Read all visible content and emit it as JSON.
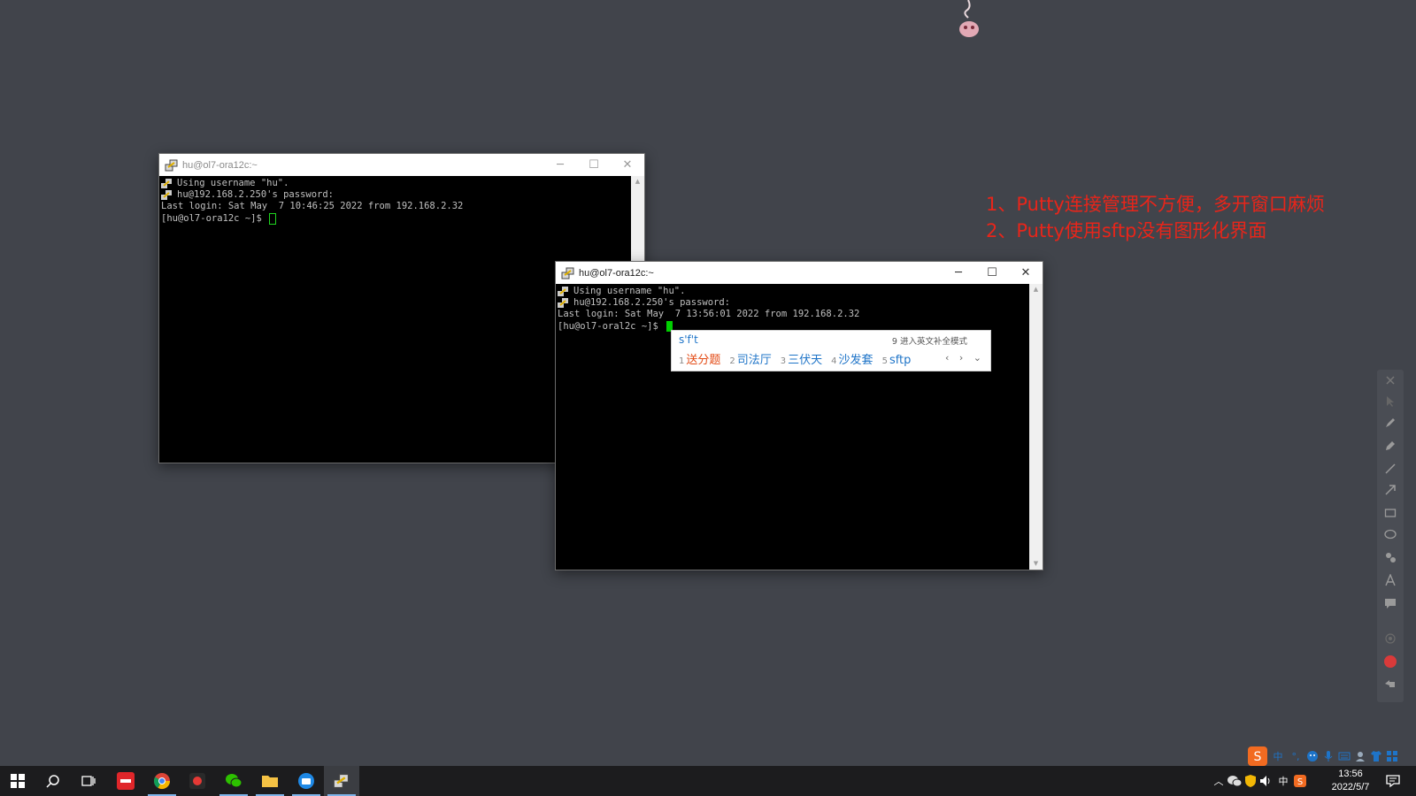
{
  "windows": [
    {
      "title": "hu@ol7-ora12c:~",
      "lines": [
        {
          "icon": true,
          "text": "Using username \"hu\"."
        },
        {
          "icon": true,
          "text": "hu@192.168.2.250's password:"
        },
        {
          "icon": false,
          "text": "Last login: Sat May  7 10:46:25 2022 from 192.168.2.32"
        },
        {
          "icon": false,
          "text": "[hu@ol7-ora12c ~]$ "
        }
      ]
    },
    {
      "title": "hu@ol7-ora12c:~",
      "lines": [
        {
          "icon": true,
          "text": "Using username \"hu\"."
        },
        {
          "icon": true,
          "text": "hu@192.168.2.250's password:"
        },
        {
          "icon": false,
          "text": "Last login: Sat May  7 13:56:01 2022 from 192.168.2.32"
        },
        {
          "icon": false,
          "text": "[hu@ol7-oral2c ~]$ "
        }
      ]
    }
  ],
  "window_buttons": {
    "minimize": "─",
    "maximize": "☐",
    "close": "✕"
  },
  "ime_popup": {
    "composition": "s'f't",
    "hint": "9 进入英文补全模式",
    "candidates": [
      {
        "num": "1",
        "text": "送分题"
      },
      {
        "num": "2",
        "text": "司法厅"
      },
      {
        "num": "3",
        "text": "三伏天"
      },
      {
        "num": "4",
        "text": "沙发套"
      },
      {
        "num": "5",
        "text": "sftp"
      }
    ],
    "nav": "‹ › ⌄"
  },
  "annotations": [
    "1、Putty连接管理不方便，多开窗口麻烦",
    "2、Putty使用sftp没有图形化界面"
  ],
  "ime_status": {
    "mode": "中",
    "punct": "°,"
  },
  "tray": {
    "lang": "中"
  },
  "clock": {
    "time": "13:56",
    "date": "2022/5/7"
  },
  "colors": {
    "annotation": "#e8251a",
    "ime_accent": "#1e74c8",
    "cursor": "#00d000"
  }
}
